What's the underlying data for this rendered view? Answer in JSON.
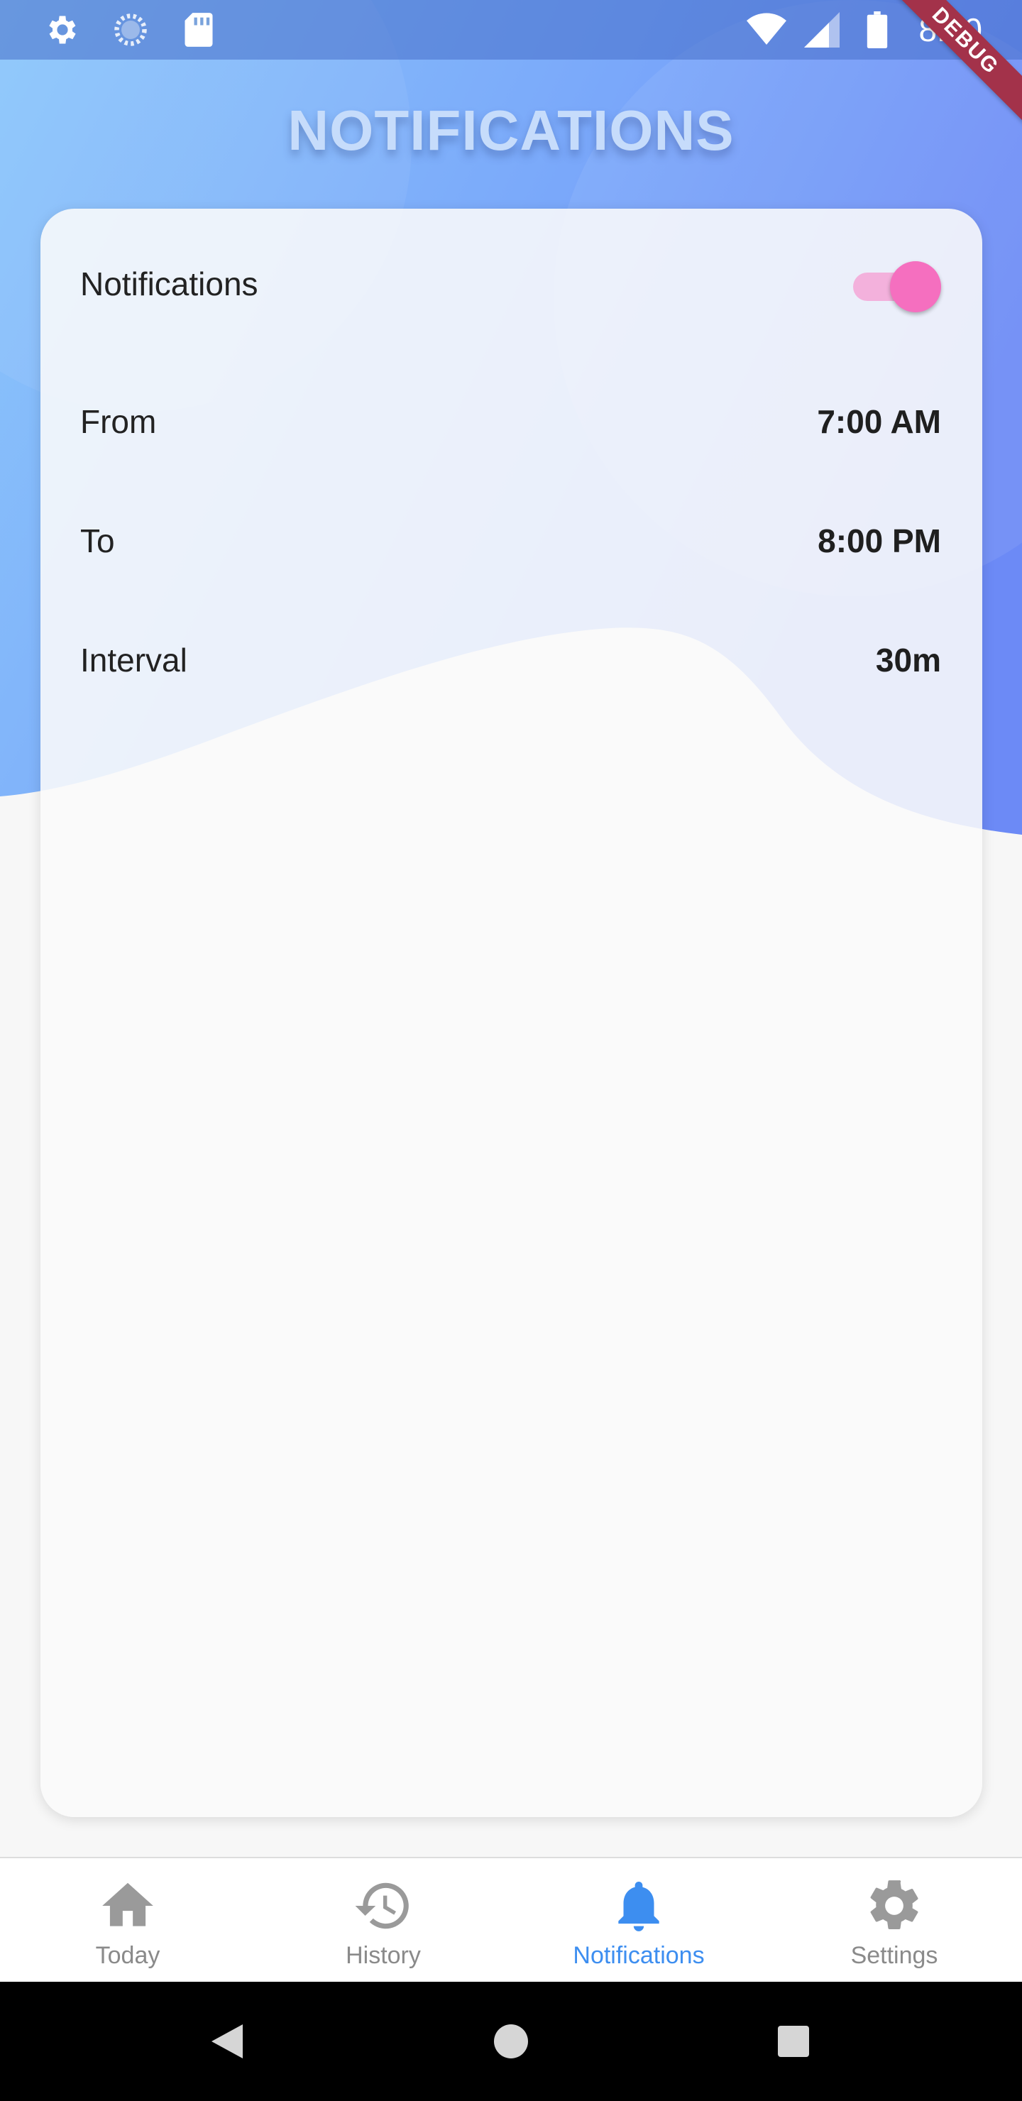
{
  "status_bar": {
    "time": "8:00",
    "left_icons": [
      "gear-icon",
      "loading-icon",
      "sd-card-icon"
    ],
    "right_icons": [
      "wifi-icon",
      "signal-icon",
      "battery-icon"
    ],
    "debug_label": "DEBUG"
  },
  "header": {
    "title": "NOTIFICATIONS"
  },
  "settings": {
    "notifications_label": "Notifications",
    "notifications_enabled": true,
    "from_label": "From",
    "from_value": "7:00 AM",
    "to_label": "To",
    "to_value": "8:00 PM",
    "interval_label": "Interval",
    "interval_value": "30m"
  },
  "bottom_nav": {
    "items": [
      {
        "label": "Today",
        "icon": "home-icon",
        "active": false
      },
      {
        "label": "History",
        "icon": "history-icon",
        "active": false
      },
      {
        "label": "Notifications",
        "icon": "bell-icon",
        "active": true
      },
      {
        "label": "Settings",
        "icon": "gear-icon",
        "active": false
      }
    ]
  },
  "colors": {
    "accent": "#3d8ef0",
    "toggle_thumb": "#f56fbf",
    "toggle_track": "#f3b1dc",
    "inactive": "#8a8a8a",
    "header_gradient_start": "#8dc4fb",
    "header_gradient_end": "#6e8ef8"
  }
}
